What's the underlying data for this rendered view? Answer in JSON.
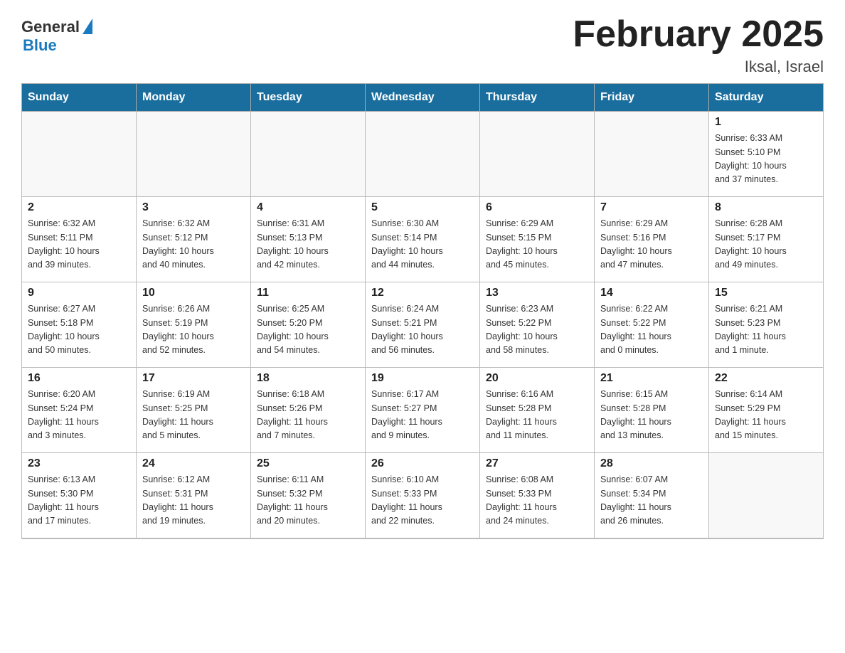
{
  "logo": {
    "general": "General",
    "blue": "Blue",
    "triangle_color": "#1a7abf"
  },
  "title": "February 2025",
  "location": "Iksal, Israel",
  "header": {
    "days": [
      "Sunday",
      "Monday",
      "Tuesday",
      "Wednesday",
      "Thursday",
      "Friday",
      "Saturday"
    ]
  },
  "weeks": [
    {
      "cells": [
        {
          "day": null,
          "info": null
        },
        {
          "day": null,
          "info": null
        },
        {
          "day": null,
          "info": null
        },
        {
          "day": null,
          "info": null
        },
        {
          "day": null,
          "info": null
        },
        {
          "day": null,
          "info": null
        },
        {
          "day": "1",
          "info": "Sunrise: 6:33 AM\nSunset: 5:10 PM\nDaylight: 10 hours\nand 37 minutes."
        }
      ]
    },
    {
      "cells": [
        {
          "day": "2",
          "info": "Sunrise: 6:32 AM\nSunset: 5:11 PM\nDaylight: 10 hours\nand 39 minutes."
        },
        {
          "day": "3",
          "info": "Sunrise: 6:32 AM\nSunset: 5:12 PM\nDaylight: 10 hours\nand 40 minutes."
        },
        {
          "day": "4",
          "info": "Sunrise: 6:31 AM\nSunset: 5:13 PM\nDaylight: 10 hours\nand 42 minutes."
        },
        {
          "day": "5",
          "info": "Sunrise: 6:30 AM\nSunset: 5:14 PM\nDaylight: 10 hours\nand 44 minutes."
        },
        {
          "day": "6",
          "info": "Sunrise: 6:29 AM\nSunset: 5:15 PM\nDaylight: 10 hours\nand 45 minutes."
        },
        {
          "day": "7",
          "info": "Sunrise: 6:29 AM\nSunset: 5:16 PM\nDaylight: 10 hours\nand 47 minutes."
        },
        {
          "day": "8",
          "info": "Sunrise: 6:28 AM\nSunset: 5:17 PM\nDaylight: 10 hours\nand 49 minutes."
        }
      ]
    },
    {
      "cells": [
        {
          "day": "9",
          "info": "Sunrise: 6:27 AM\nSunset: 5:18 PM\nDaylight: 10 hours\nand 50 minutes."
        },
        {
          "day": "10",
          "info": "Sunrise: 6:26 AM\nSunset: 5:19 PM\nDaylight: 10 hours\nand 52 minutes."
        },
        {
          "day": "11",
          "info": "Sunrise: 6:25 AM\nSunset: 5:20 PM\nDaylight: 10 hours\nand 54 minutes."
        },
        {
          "day": "12",
          "info": "Sunrise: 6:24 AM\nSunset: 5:21 PM\nDaylight: 10 hours\nand 56 minutes."
        },
        {
          "day": "13",
          "info": "Sunrise: 6:23 AM\nSunset: 5:22 PM\nDaylight: 10 hours\nand 58 minutes."
        },
        {
          "day": "14",
          "info": "Sunrise: 6:22 AM\nSunset: 5:22 PM\nDaylight: 11 hours\nand 0 minutes."
        },
        {
          "day": "15",
          "info": "Sunrise: 6:21 AM\nSunset: 5:23 PM\nDaylight: 11 hours\nand 1 minute."
        }
      ]
    },
    {
      "cells": [
        {
          "day": "16",
          "info": "Sunrise: 6:20 AM\nSunset: 5:24 PM\nDaylight: 11 hours\nand 3 minutes."
        },
        {
          "day": "17",
          "info": "Sunrise: 6:19 AM\nSunset: 5:25 PM\nDaylight: 11 hours\nand 5 minutes."
        },
        {
          "day": "18",
          "info": "Sunrise: 6:18 AM\nSunset: 5:26 PM\nDaylight: 11 hours\nand 7 minutes."
        },
        {
          "day": "19",
          "info": "Sunrise: 6:17 AM\nSunset: 5:27 PM\nDaylight: 11 hours\nand 9 minutes."
        },
        {
          "day": "20",
          "info": "Sunrise: 6:16 AM\nSunset: 5:28 PM\nDaylight: 11 hours\nand 11 minutes."
        },
        {
          "day": "21",
          "info": "Sunrise: 6:15 AM\nSunset: 5:28 PM\nDaylight: 11 hours\nand 13 minutes."
        },
        {
          "day": "22",
          "info": "Sunrise: 6:14 AM\nSunset: 5:29 PM\nDaylight: 11 hours\nand 15 minutes."
        }
      ]
    },
    {
      "cells": [
        {
          "day": "23",
          "info": "Sunrise: 6:13 AM\nSunset: 5:30 PM\nDaylight: 11 hours\nand 17 minutes."
        },
        {
          "day": "24",
          "info": "Sunrise: 6:12 AM\nSunset: 5:31 PM\nDaylight: 11 hours\nand 19 minutes."
        },
        {
          "day": "25",
          "info": "Sunrise: 6:11 AM\nSunset: 5:32 PM\nDaylight: 11 hours\nand 20 minutes."
        },
        {
          "day": "26",
          "info": "Sunrise: 6:10 AM\nSunset: 5:33 PM\nDaylight: 11 hours\nand 22 minutes."
        },
        {
          "day": "27",
          "info": "Sunrise: 6:08 AM\nSunset: 5:33 PM\nDaylight: 11 hours\nand 24 minutes."
        },
        {
          "day": "28",
          "info": "Sunrise: 6:07 AM\nSunset: 5:34 PM\nDaylight: 11 hours\nand 26 minutes."
        },
        {
          "day": null,
          "info": null
        }
      ]
    }
  ]
}
